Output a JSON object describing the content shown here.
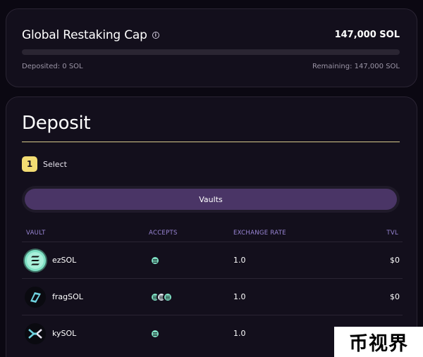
{
  "cap": {
    "title": "Global Restaking Cap",
    "info_icon": "info-icon",
    "total": "147,000 SOL",
    "deposited": "Deposited: 0 SOL",
    "remaining": "Remaining: 147,000 SOL",
    "progress_fraction": 0
  },
  "deposit": {
    "title": "Deposit",
    "step": {
      "number": "1",
      "label": "Select"
    },
    "tab_label": "Vaults",
    "columns": {
      "vault": "VAULT",
      "accepts": "ACCEPTS",
      "rate": "EXCHANGE RATE",
      "tvl": "TVL"
    },
    "rows": [
      {
        "name": "ezSOL",
        "accepts_tokens": 1,
        "rate": "1.0",
        "tvl": "$0"
      },
      {
        "name": "fragSOL",
        "accepts_tokens": 2,
        "rate": "1.0",
        "tvl": "$0"
      },
      {
        "name": "kySOL",
        "accepts_tokens": 1,
        "rate": "1.0",
        "tvl": ""
      }
    ]
  },
  "watermark": "币视界",
  "colors": {
    "accent_yellow": "#f2dc73",
    "tab_purple": "#4a3566",
    "header_purple": "#9a86d6",
    "token_green": "#7fe0c4"
  }
}
